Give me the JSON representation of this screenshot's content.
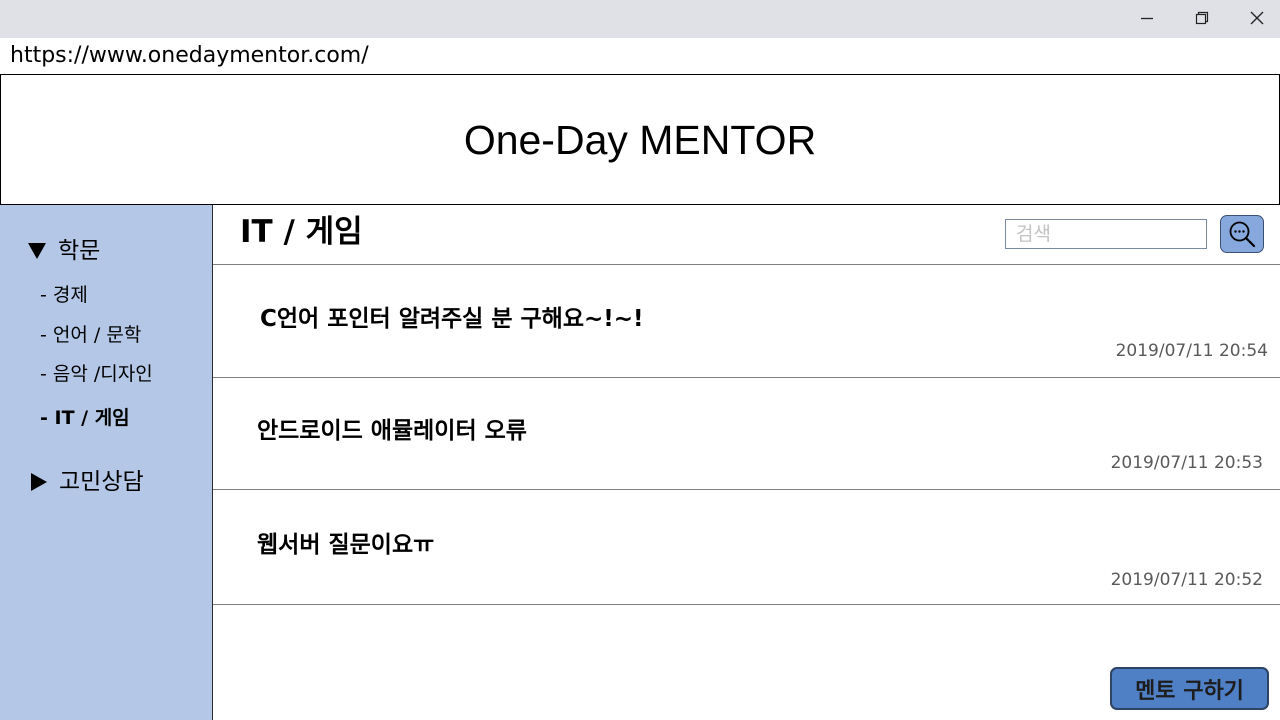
{
  "window": {
    "controls": [
      "minimize-icon",
      "restore-icon",
      "close-icon"
    ]
  },
  "browser": {
    "url": "https://www.onedaymentor.com/"
  },
  "header": {
    "title": "One-Day MENTOR"
  },
  "sidebar": {
    "categories": [
      {
        "label": "학문",
        "expanded": true,
        "items": [
          {
            "label": "- 경제"
          },
          {
            "label": "- 언어 / 문학"
          },
          {
            "label": "- 음악 /디자인"
          },
          {
            "label": "- IT / 게임",
            "active": true
          }
        ]
      },
      {
        "label": "고민상담",
        "expanded": false
      }
    ]
  },
  "main": {
    "title": "IT / 게임",
    "search": {
      "placeholder": "검색",
      "value": ""
    },
    "posts": [
      {
        "title": "C언어 포인터 알려주실 분 구해요~!~!",
        "date": "2019/07/11  20:54"
      },
      {
        "title": "안드로이드 애뮬레이터 오류",
        "date": "2019/07/11  20:53"
      },
      {
        "title": "웹서버 질문이요ㅠ",
        "date": "2019/07/11  20:52"
      }
    ],
    "action_button": "멘토 구하기"
  },
  "colors": {
    "sidebar_bg": "#b4c7e6",
    "button_bg": "#4f7fc4",
    "search_button_bg": "#86a8dd",
    "titlebar_bg": "#dfe1e6"
  }
}
